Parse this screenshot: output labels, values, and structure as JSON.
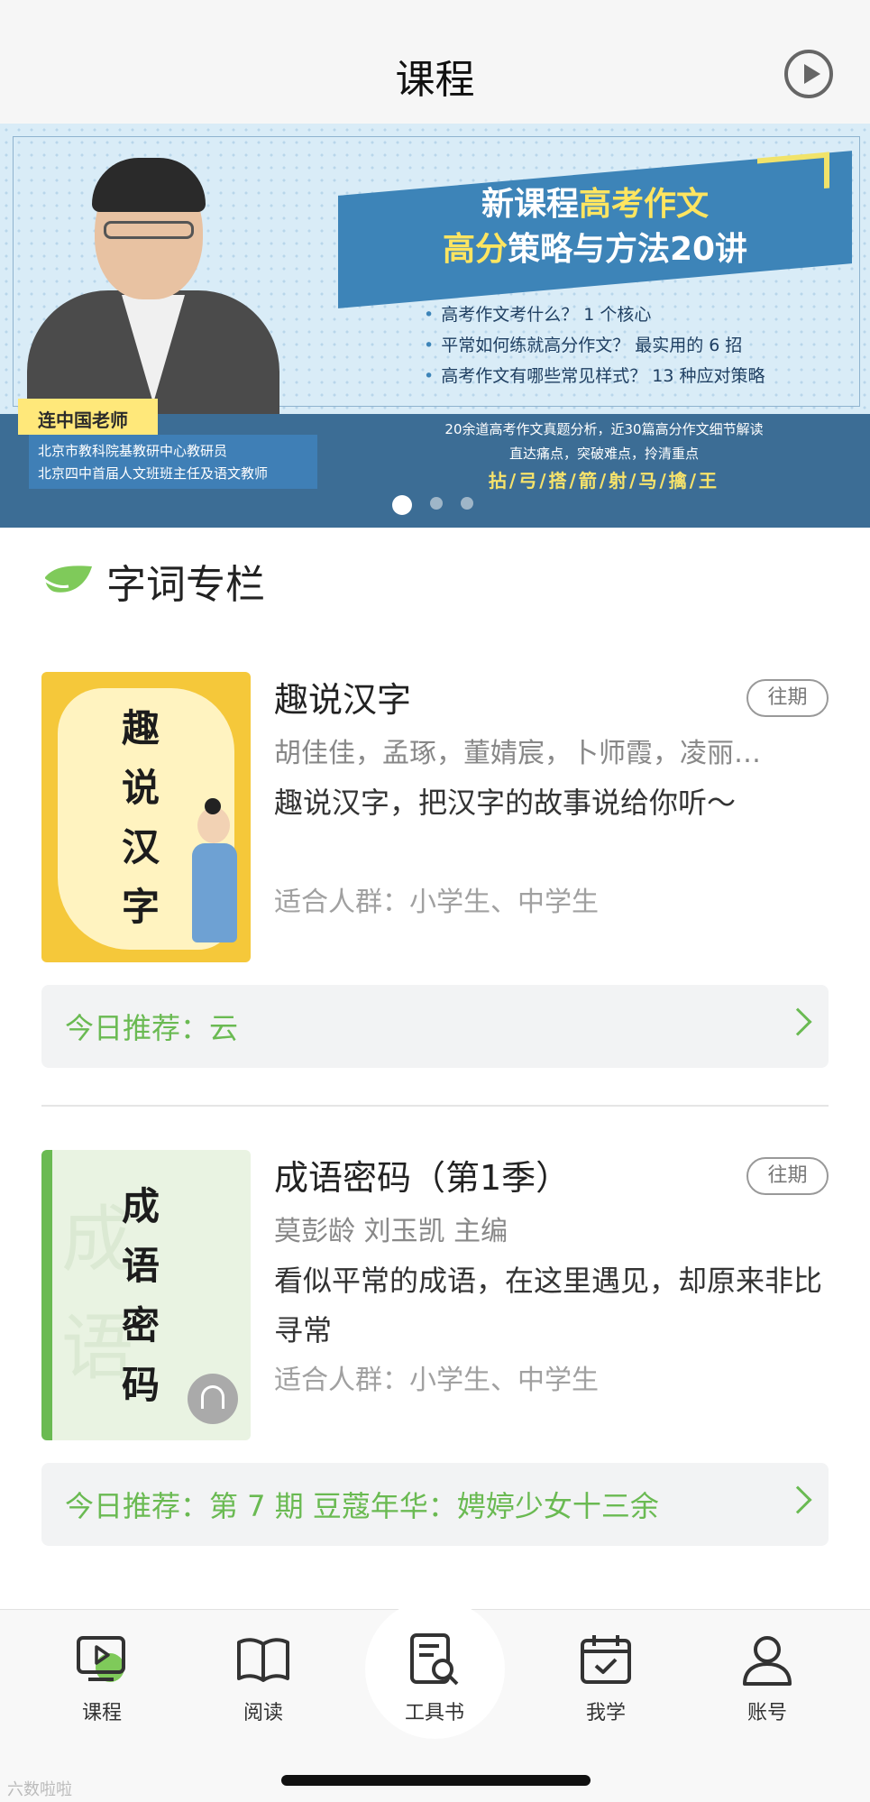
{
  "header": {
    "title": "课程",
    "play_icon": "play-circle-icon"
  },
  "banner": {
    "title_line1_a": "新课程",
    "title_line1_b": "高考作文",
    "title_line2_a": "高分",
    "title_line2_b": "策略与方法20讲",
    "bullets": [
      "高考作文考什么？ 1 个核心",
      "平常如何练就高分作文？ 最实用的 6 招",
      "高考作文有哪些常见样式？ 13 种应对策略"
    ],
    "teacher_name": "连中国老师",
    "teacher_desc1": "北京市教科院基教研中心教研员",
    "teacher_desc2": "北京四中首届人文班班主任及语文教师",
    "bottom_line1": "20余道高考作文真题分析，近30篇高分作文细节解读",
    "bottom_line2": "直达痛点，突破难点，拎清重点",
    "bottom_line3": "拈/弓/搭/箭/射/马/擒/王",
    "dots": 3,
    "active_dot": 1
  },
  "section": {
    "title": "字词专栏",
    "icon": "leaf-icon"
  },
  "cards": [
    {
      "cover_chars": [
        "趣",
        "说",
        "汉",
        "字"
      ],
      "title": "趣说汉字",
      "tag": "往期",
      "author": "胡佳佳，孟琢，董婧宸，卜师霞，凌丽…",
      "desc": "趣说汉字，把汉字的故事说给你听～",
      "audience": "适合人群：小学生、中学生",
      "recommend": "今日推荐：云",
      "colors": {
        "cover_bg": "#f5c83a",
        "cover_inner": "#fff3c0"
      }
    },
    {
      "cover_chars": [
        "成",
        "语",
        "密",
        "码"
      ],
      "title": "成语密码（第1季）",
      "tag": "往期",
      "author": "莫彭龄 刘玉凯 主编",
      "desc": "看似平常的成语，在这里遇见，却原来非比寻常",
      "audience": "适合人群：小学生、中学生",
      "recommend": "今日推荐：第 7 期  豆蔻年华：娉婷少女十三余",
      "colors": {
        "cover_bg": "#e9f3e2",
        "cover_bar": "#6aba52"
      }
    }
  ],
  "tabbar": {
    "tabs": [
      {
        "label": "课程",
        "icon": "course-icon"
      },
      {
        "label": "阅读",
        "icon": "book-icon"
      },
      {
        "label": "工具书",
        "icon": "dictionary-icon"
      },
      {
        "label": "我学",
        "icon": "calendar-check-icon"
      },
      {
        "label": "账号",
        "icon": "person-icon"
      }
    ]
  },
  "watermark": "六数啦啦",
  "colors": {
    "accent_green": "#6aba52",
    "banner_blue": "#3d84b8"
  }
}
